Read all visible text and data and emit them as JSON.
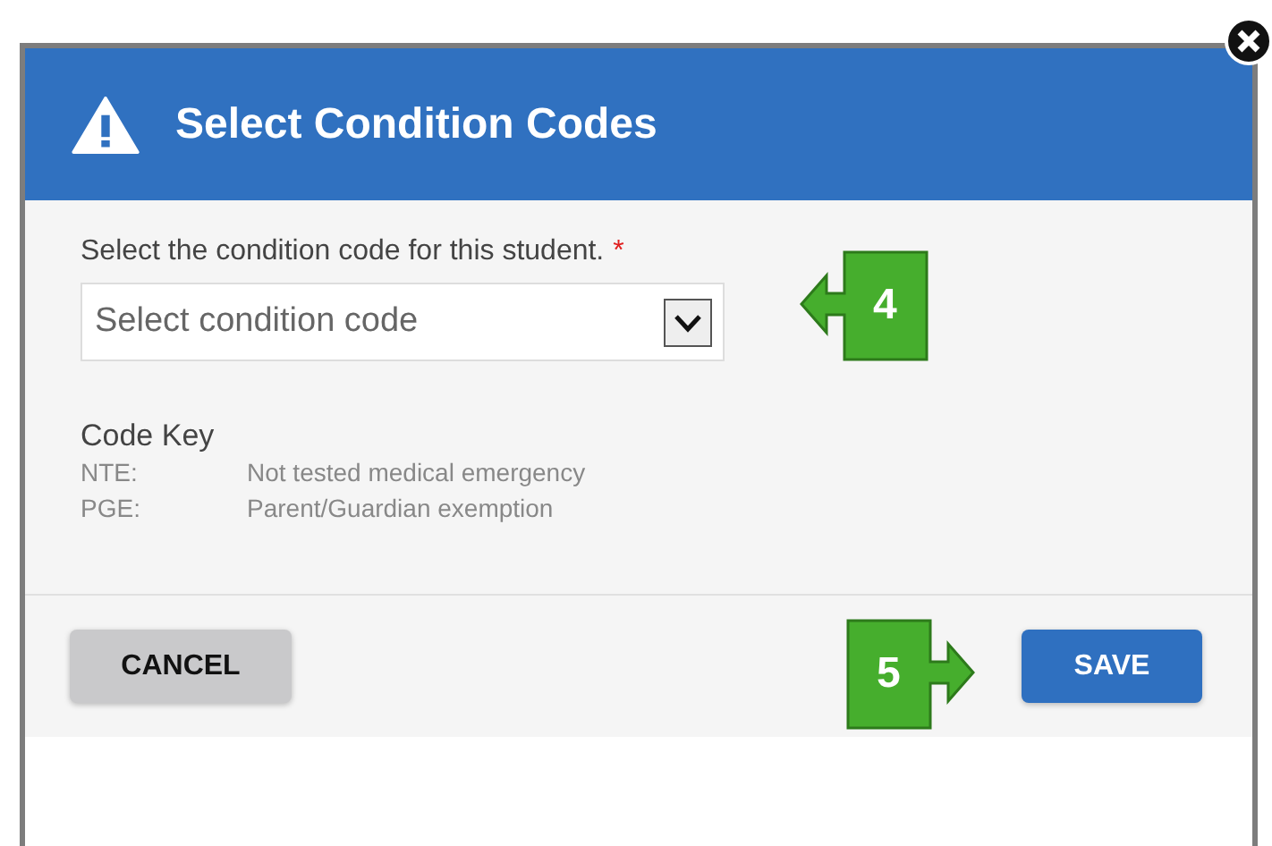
{
  "dialog": {
    "title": "Select Condition Codes",
    "field": {
      "label": "Select the condition code for this student.",
      "required_mark": "*",
      "placeholder": "Select condition code"
    },
    "code_key": {
      "heading": "Code Key",
      "rows": [
        {
          "code": "NTE:",
          "description": "Not tested medical emergency"
        },
        {
          "code": "PGE:",
          "description": "Parent/Guardian exemption"
        }
      ]
    },
    "buttons": [
      {
        "label": "CANCEL",
        "kind": "secondary"
      },
      {
        "label": "SAVE",
        "kind": "primary"
      }
    ]
  },
  "callouts": [
    {
      "number": "4",
      "kind": "left"
    },
    {
      "number": "5",
      "kind": "right"
    }
  ]
}
